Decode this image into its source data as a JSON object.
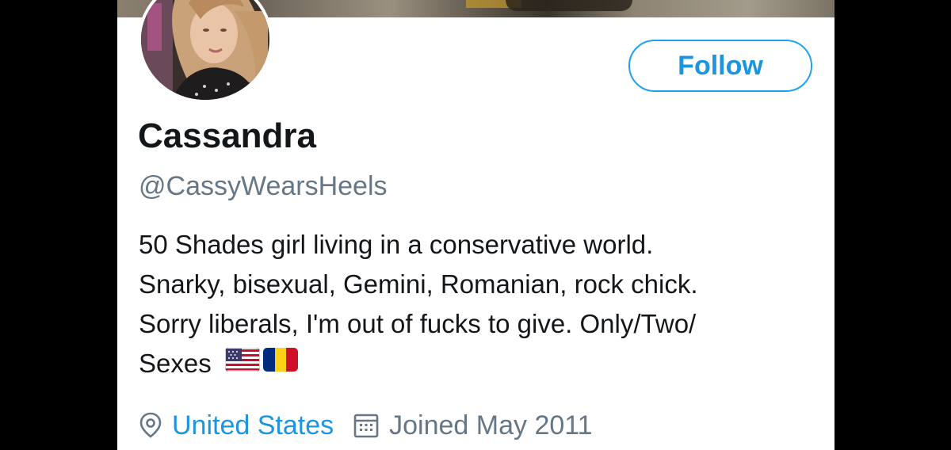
{
  "profile": {
    "display_name": "Cassandra",
    "handle": "@CassyWearsHeels",
    "bio_lines": [
      "50 Shades girl living in a conservative world.",
      "Snarky, bisexual, Gemini, Romanian, rock chick.",
      "Sorry liberals, I'm out of fucks to give. Only/Two/",
      "Sexes"
    ],
    "bio_flags": [
      "us-flag-icon",
      "romania-flag-icon"
    ],
    "location": "United States",
    "joined": "Joined May 2011"
  },
  "actions": {
    "follow_label": "Follow"
  },
  "icons": {
    "location": "location-pin-icon",
    "calendar": "calendar-icon"
  },
  "colors": {
    "accent": "#1da1f2",
    "link": "#1b95e0",
    "text": "#14171a",
    "muted": "#657786",
    "background": "#ffffff"
  }
}
